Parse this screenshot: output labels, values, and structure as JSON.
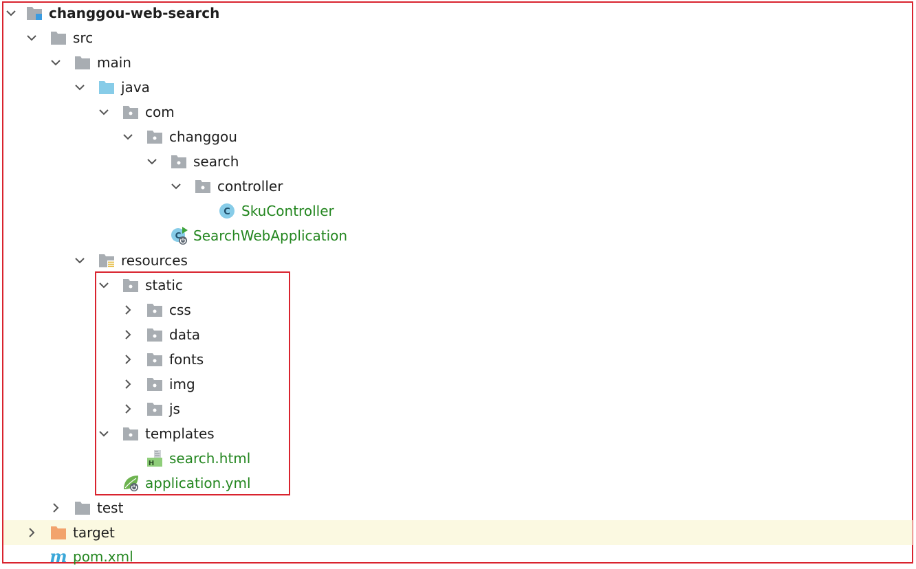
{
  "tree": {
    "root": "changgou-web-search",
    "src": "src",
    "main": "main",
    "java": "java",
    "com": "com",
    "changgou": "changgou",
    "search": "search",
    "controller": "controller",
    "sku_controller": "SkuController",
    "search_web_application": "SearchWebApplication",
    "resources": "resources",
    "static": "static",
    "css": "css",
    "data": "data",
    "fonts": "fonts",
    "img": "img",
    "js": "js",
    "templates": "templates",
    "search_html": "search.html",
    "application_yml": "application.yml",
    "test": "test",
    "target": "target",
    "pom_xml": "pom.xml"
  },
  "colors": {
    "highlight_border": "#d9232e",
    "folder_gray": "#a8adb2",
    "source_folder_blue": "#87cce8",
    "excluded_folder_orange": "#f2a36c",
    "file_text_green": "#23861f",
    "selected_row": "#fbf9e1"
  }
}
